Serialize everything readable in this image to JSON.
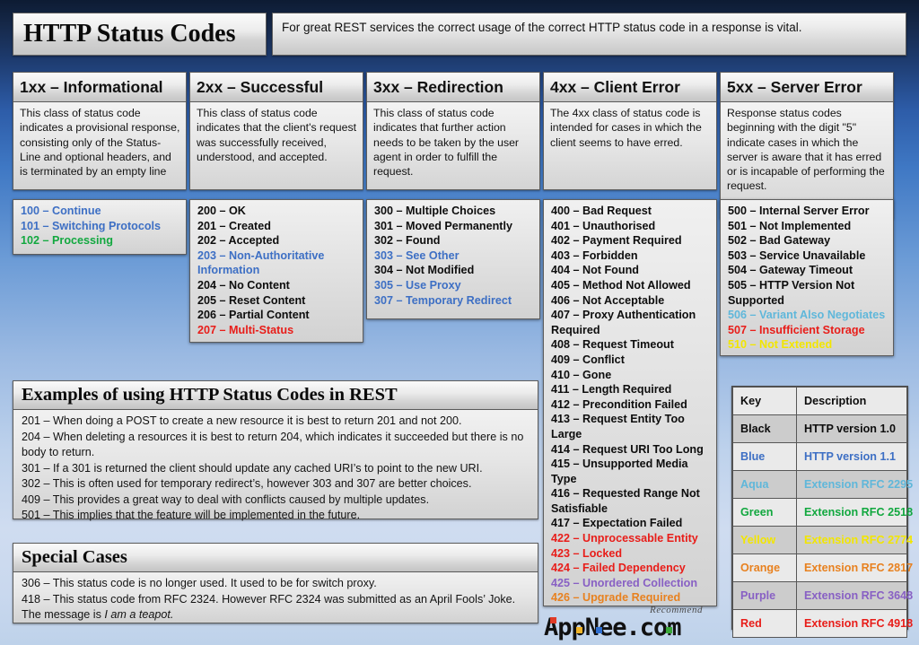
{
  "header": {
    "title": "HTTP Status Codes",
    "subtitle": "For great REST services the correct usage of the correct HTTP status code in a response is vital."
  },
  "columns": [
    {
      "heading": "1xx – Informational",
      "description": "This class of status code indicates a provisional response, consisting only of the Status-Line and optional headers, and is terminated by an empty line",
      "codes": [
        {
          "text": "100 – Continue",
          "color": "blue"
        },
        {
          "text": "101 – Switching Protocols",
          "color": "blue"
        },
        {
          "text": "102 – Processing",
          "color": "green"
        }
      ]
    },
    {
      "heading": "2xx – Successful",
      "description": "This class of status code indicates that the client's request was successfully received, understood, and accepted.",
      "codes": [
        {
          "text": "200 – OK",
          "color": "black"
        },
        {
          "text": "201 – Created",
          "color": "black"
        },
        {
          "text": "202 – Accepted",
          "color": "black"
        },
        {
          "text": "203 – Non-Authoritative Information",
          "color": "blue"
        },
        {
          "text": "204 – No Content",
          "color": "black"
        },
        {
          "text": "205 – Reset Content",
          "color": "black"
        },
        {
          "text": "206 – Partial Content",
          "color": "black"
        },
        {
          "text": "207 – Multi-Status",
          "color": "red"
        }
      ]
    },
    {
      "heading": "3xx – Redirection",
      "description": "This class of status code indicates that further action needs to be taken by the user agent in order to fulfill the request.",
      "codes": [
        {
          "text": "300 – Multiple Choices",
          "color": "black"
        },
        {
          "text": "301 – Moved Permanently",
          "color": "black"
        },
        {
          "text": "302 – Found",
          "color": "black"
        },
        {
          "text": "303 – See Other",
          "color": "blue"
        },
        {
          "text": "304 – Not Modified",
          "color": "black"
        },
        {
          "text": "305 – Use Proxy",
          "color": "blue"
        },
        {
          "text": "307 – Temporary Redirect",
          "color": "blue"
        }
      ]
    },
    {
      "heading": "4xx – Client Error",
      "description": "The 4xx class of status code is intended for cases in which the client seems to have erred.",
      "codes": [
        {
          "text": "400 – Bad Request",
          "color": "black"
        },
        {
          "text": "401 – Unauthorised",
          "color": "black"
        },
        {
          "text": "402 – Payment Required",
          "color": "black"
        },
        {
          "text": "403 – Forbidden",
          "color": "black"
        },
        {
          "text": "404 – Not Found",
          "color": "black"
        },
        {
          "text": "405 – Method Not Allowed",
          "color": "black"
        },
        {
          "text": "406 – Not Acceptable",
          "color": "black"
        },
        {
          "text": "407 – Proxy Authentication Required",
          "color": "black"
        },
        {
          "text": "408 – Request Timeout",
          "color": "black"
        },
        {
          "text": "409 – Conflict",
          "color": "black"
        },
        {
          "text": "410 – Gone",
          "color": "black"
        },
        {
          "text": "411 – Length Required",
          "color": "black"
        },
        {
          "text": "412 – Precondition Failed",
          "color": "black"
        },
        {
          "text": "413 – Request Entity Too Large",
          "color": "black"
        },
        {
          "text": "414 – Request URI Too Long",
          "color": "black"
        },
        {
          "text": "415 – Unsupported Media Type",
          "color": "black"
        },
        {
          "text": "416 – Requested Range Not Satisfiable",
          "color": "black"
        },
        {
          "text": "417 – Expectation Failed",
          "color": "black"
        },
        {
          "text": "422 – Unprocessable Entity",
          "color": "red"
        },
        {
          "text": "423 – Locked",
          "color": "red"
        },
        {
          "text": "424 – Failed Dependency",
          "color": "red"
        },
        {
          "text": "425 – Unordered Collection",
          "color": "purple"
        },
        {
          "text": "426 – Upgrade Required",
          "color": "orange"
        }
      ]
    },
    {
      "heading": "5xx – Server Error",
      "description": "Response status codes beginning with the digit \"5\" indicate cases in which the server is aware that it has erred or is incapable of performing the request.",
      "codes": [
        {
          "text": "500 – Internal Server Error",
          "color": "black"
        },
        {
          "text": "501 – Not Implemented",
          "color": "black"
        },
        {
          "text": "502 – Bad Gateway",
          "color": "black"
        },
        {
          "text": "503 – Service Unavailable",
          "color": "black"
        },
        {
          "text": "504 – Gateway Timeout",
          "color": "black"
        },
        {
          "text": "505 – HTTP Version Not Supported",
          "color": "black"
        },
        {
          "text": "506 – Variant Also Negotiates",
          "color": "aqua"
        },
        {
          "text": "507 – Insufficient Storage",
          "color": "red"
        },
        {
          "text": "510 – Not Extended",
          "color": "yellow"
        }
      ]
    }
  ],
  "examples": {
    "heading": "Examples of using HTTP Status Codes in REST",
    "lines": [
      "201 – When doing a POST to create a new resource it is best to return 201 and not 200.",
      "204 – When deleting a resources it is best to return 204, which indicates it succeeded but there is no body to return.",
      "301 – If a 301 is returned the client should update any cached URI’s to point to the new URI.",
      "302 – This is often used for temporary redirect’s, however 303 and 307 are better choices.",
      "409 – This provides a great way to deal with conflicts caused by multiple updates.",
      "501 – This implies that the feature will be implemented in the future."
    ]
  },
  "special_cases": {
    "heading": "Special Cases",
    "lines": [
      "306 – This status code is no longer used. It used to be for switch proxy.",
      "418 – This status code from RFC 2324. However RFC 2324 was submitted as an April Fools’ Joke. The message is "
    ],
    "italic_tail": "I am a teapot."
  },
  "key_table": {
    "columns": [
      "Key",
      "Description"
    ],
    "rows": [
      {
        "key": "Black",
        "description": "HTTP version 1.0",
        "color": "black"
      },
      {
        "key": "Blue",
        "description": "HTTP version 1.1",
        "color": "blue"
      },
      {
        "key": "Aqua",
        "description": "Extension RFC 2295",
        "color": "aqua"
      },
      {
        "key": "Green",
        "description": "Extension RFC 2518",
        "color": "green"
      },
      {
        "key": "Yellow",
        "description": "Extension RFC 2774",
        "color": "yellow"
      },
      {
        "key": "Orange",
        "description": "Extension RFC 2817",
        "color": "orange"
      },
      {
        "key": "Purple",
        "description": "Extension RFC 3648",
        "color": "purple"
      },
      {
        "key": "Red",
        "description": "Extension RFC 4918",
        "color": "red"
      }
    ]
  },
  "watermark": {
    "brand": "AppNee.com",
    "tagline": "Recommend"
  },
  "palette": {
    "black": "#0d0d0d",
    "blue": "#3d6fc4",
    "aqua": "#5fb7da",
    "green": "#12a83f",
    "yellow": "#f2e600",
    "orange": "#e8811f",
    "purple": "#8860c4",
    "red": "#e81d19"
  }
}
